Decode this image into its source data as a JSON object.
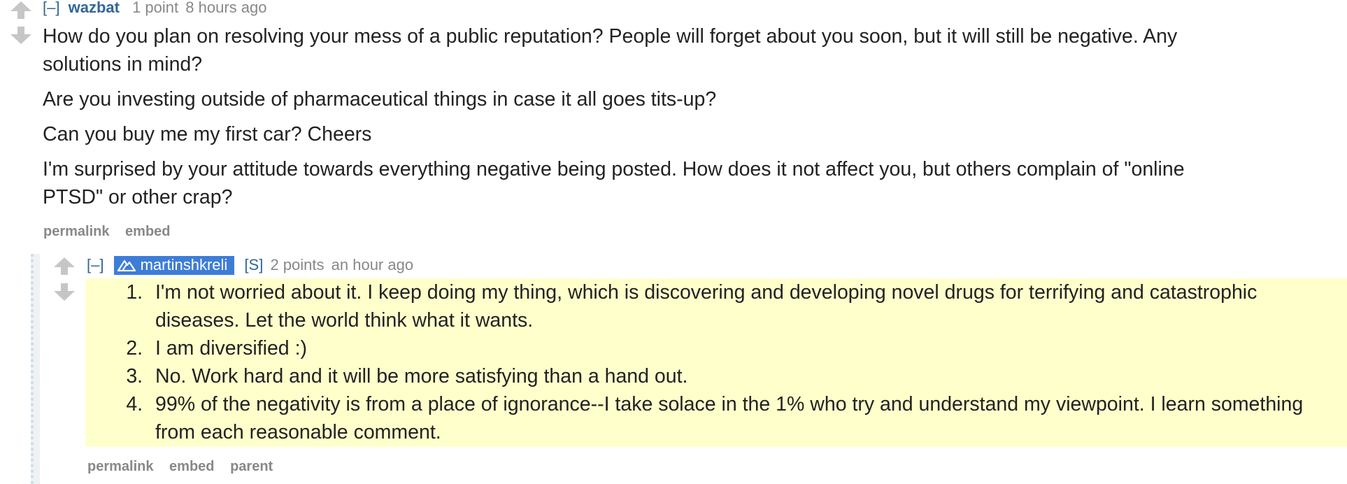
{
  "comment": {
    "collapse": "[–]",
    "author": "wazbat",
    "score": "1 point",
    "time": "8 hours ago",
    "paragraphs": [
      "How do you plan on resolving your mess of a public reputation? People will forget about you soon, but it will still be negative. Any solutions in mind?",
      "Are you investing outside of pharmaceutical things in case it all goes tits-up?",
      "Can you buy me my first car? Cheers",
      "I'm surprised by your attitude towards everything negative being posted. How does it not affect you, but others complain of \"online PTSD\" or other crap?"
    ],
    "buttons": {
      "permalink": "permalink",
      "embed": "embed"
    }
  },
  "reply": {
    "collapse": "[–]",
    "author": "martinshkreli",
    "submitter_tag": "[S]",
    "score": "2 points",
    "time": "an hour ago",
    "items": [
      "I'm not worried about it. I keep doing my thing, which is discovering and developing novel drugs for terrifying and catastrophic diseases. Let the world think what it wants.",
      "I am diversified :)",
      "No. Work hard and it will be more satisfying than a hand out.",
      "99% of the negativity is from a place of ignorance--I take solace in the 1% who try and understand my viewpoint. I learn something from each reasonable comment."
    ],
    "buttons": {
      "permalink": "permalink",
      "embed": "embed",
      "parent": "parent"
    }
  },
  "colors": {
    "author_link": "#336699",
    "op_badge": "#3d7dd8",
    "meta_gray": "#888888",
    "arrow_gray": "#c6c6c6",
    "highlight": "#ffffcc"
  },
  "icons": {
    "upvote": "upvote-arrow-icon",
    "downvote": "downvote-arrow-icon",
    "op": "op-mountain-icon"
  }
}
